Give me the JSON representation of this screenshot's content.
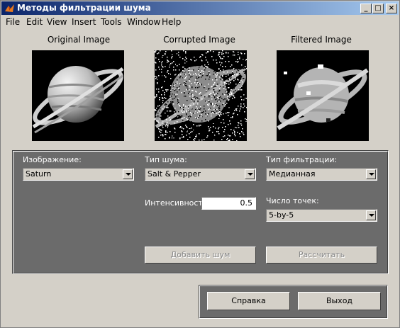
{
  "window": {
    "title": "Методы фильтрации шума",
    "minimize_glyph": "_",
    "maximize_glyph": "□",
    "close_glyph": "×",
    "icon": "matlab-icon"
  },
  "menu": [
    "File",
    "Edit",
    "View",
    "Insert",
    "Tools",
    "Window",
    "Help"
  ],
  "images": {
    "original_caption": "Original Image",
    "corrupted_caption": "Corrupted Image",
    "filtered_caption": "Filtered Image"
  },
  "controls": {
    "image_label": "Изображение:",
    "image_value": "Saturn",
    "noise_type_label": "Тип шума:",
    "noise_type_value": "Salt & Pepper",
    "filter_type_label": "Тип фильтрации:",
    "filter_type_value": "Медианная",
    "intensity_label": "Интенсивность",
    "intensity_value": "0.5",
    "points_label": "Число точек:",
    "points_value": "5-by-5",
    "add_noise_button": "Добавить шум",
    "compute_button": "Рассчитать"
  },
  "bottom": {
    "help_button": "Справка",
    "exit_button": "Выход"
  },
  "colors": {
    "panel": "#6b6b6b",
    "face": "#d4d0c8",
    "title_start": "#0a246a",
    "title_end": "#a6caf0"
  }
}
